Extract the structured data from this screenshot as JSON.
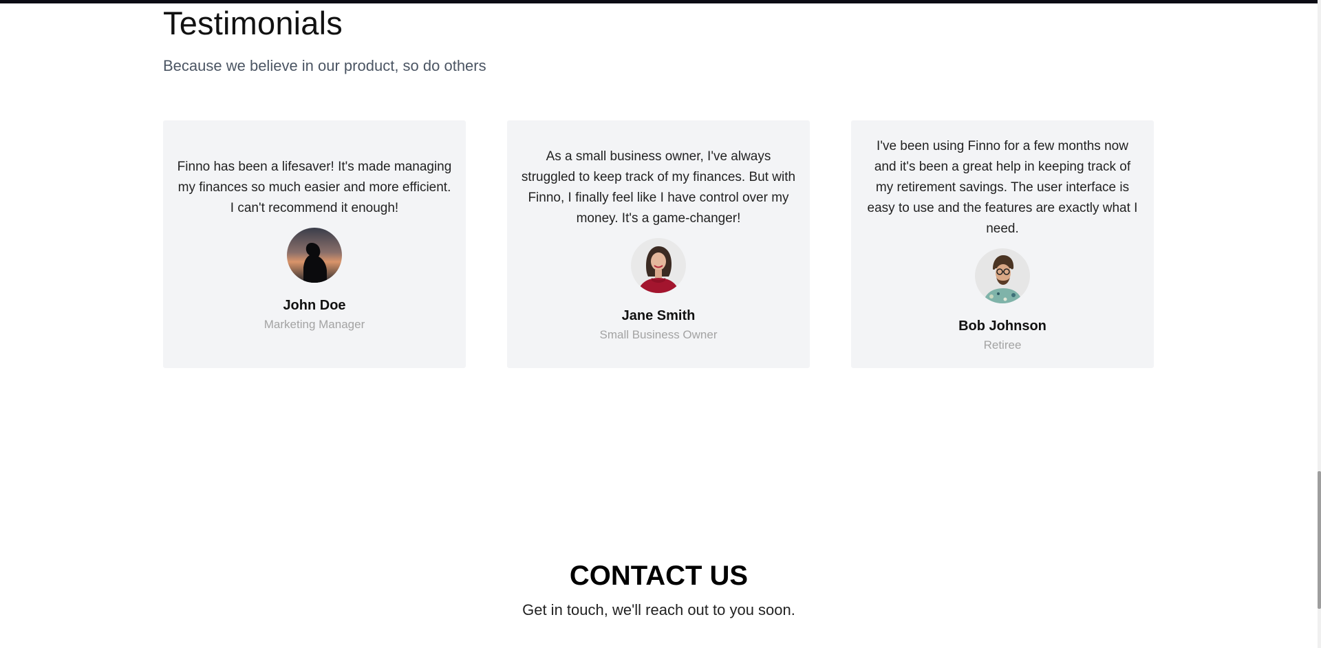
{
  "testimonials": {
    "title": "Testimonials",
    "subtitle": "Because we believe in our product, so do others",
    "items": [
      {
        "quote": "Finno has been a lifesaver! It's made managing my finances so much easier and more efficient. I can't recommend it enough!",
        "name": "John Doe",
        "role": "Marketing Manager",
        "avatar": "silhouette-sunset-avatar"
      },
      {
        "quote": "As a small business owner, I've always struggled to keep track of my finances. But with Finno, I finally feel like I have control over my money. It's a game-changer!",
        "name": "Jane Smith",
        "role": "Small Business Owner",
        "avatar": "woman-red-sweater-avatar"
      },
      {
        "quote": "I've been using Finno for a few months now and it's been a great help in keeping track of my retirement savings. The user interface is easy to use and the features are exactly what I need.",
        "name": "Bob Johnson",
        "role": "Retiree",
        "avatar": "man-glasses-avatar"
      }
    ]
  },
  "contact": {
    "title": "CONTACT US",
    "subtitle": "Get in touch, we'll reach out to you soon."
  },
  "colors": {
    "card_background": "#f3f4f6",
    "subtitle_text": "#4b5563",
    "role_text": "#a3a3a3"
  }
}
